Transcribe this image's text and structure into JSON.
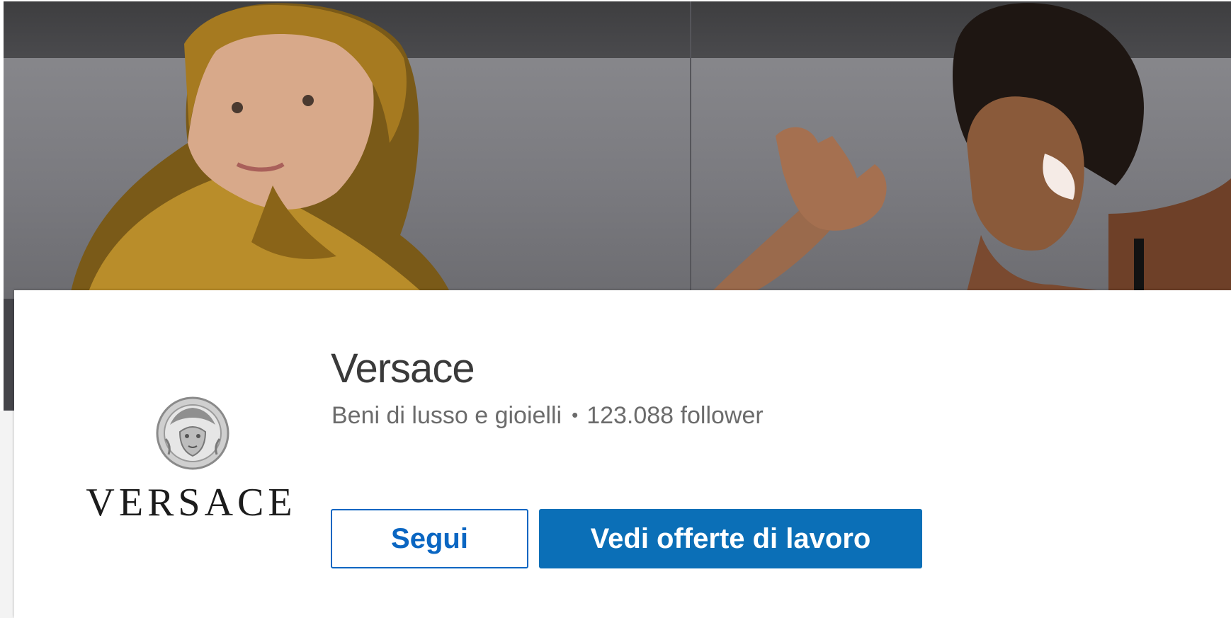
{
  "banner": {
    "image": "versace-campaign-cover"
  },
  "company": {
    "logo_text": "VERSACE",
    "name": "Versace",
    "industry": "Beni di lusso e gioielli",
    "separator": "•",
    "followers": "123.088 follower"
  },
  "actions": {
    "follow_label": "Segui",
    "jobs_label": "Vedi offerte di lavoro"
  },
  "colors": {
    "primary": "#0b6fb7",
    "follow_border": "#0a66c2",
    "text_dark": "#3a3a3a",
    "text_muted": "#6b6b6b"
  }
}
